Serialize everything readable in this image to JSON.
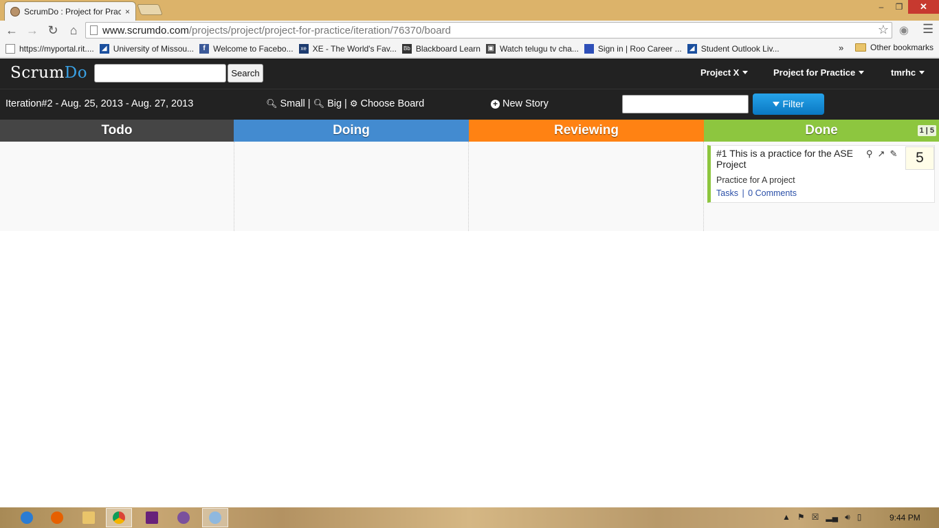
{
  "browser": {
    "tab_title": "ScrumDo : Project for Prac",
    "tab_close": "×",
    "url_host": "www.scrumdo.com",
    "url_path": "/projects/project/project-for-practice/iteration/76370/board",
    "window_controls": {
      "minimize": "–",
      "restore": "❐",
      "close": "✕"
    }
  },
  "bookmarks": {
    "items": [
      {
        "label": "https://myportal.rit....",
        "icon": "page-icon",
        "color": "#ffffff"
      },
      {
        "label": "University of Missou...",
        "icon": "umkc-icon",
        "color": "#1b4f9e"
      },
      {
        "label": "Welcome to Facebo...",
        "icon": "facebook-icon",
        "color": "#3b5998"
      },
      {
        "label": "XE - The World's Fav...",
        "icon": "xe-icon",
        "color": "#1d3b6f"
      },
      {
        "label": "Blackboard Learn",
        "icon": "blackboard-icon",
        "color": "#333333"
      },
      {
        "label": "Watch telugu tv cha...",
        "icon": "tv-icon",
        "color": "#444444"
      },
      {
        "label": "Sign in | Roo Career ...",
        "icon": "roo-icon",
        "color": "#2e4fb8"
      },
      {
        "label": "Student Outlook Liv...",
        "icon": "umkc-icon",
        "color": "#1b4f9e"
      }
    ],
    "more": "»",
    "other": "Other bookmarks"
  },
  "app": {
    "logo_scrum": "Scrum",
    "logo_do": "Do",
    "search_button": "Search",
    "menus": [
      "Project X",
      "Project for Practice",
      "tmrhc"
    ]
  },
  "iteration": {
    "title": "Iteration#2 - Aug. 25, 2013 - Aug. 27, 2013",
    "small": "Small",
    "big": "Big",
    "choose_board": "Choose Board",
    "separator": "|",
    "new_story": "New Story",
    "filter": "Filter"
  },
  "board": {
    "columns": [
      {
        "name": "Todo",
        "color": "#454545"
      },
      {
        "name": "Doing",
        "color": "#438bd0"
      },
      {
        "name": "Reviewing",
        "color": "#ff8213"
      },
      {
        "name": "Done",
        "color": "#8dc63f"
      }
    ],
    "done_count": "1 | 5",
    "card": {
      "title": "#1  This is a practice for the ASE Project",
      "description": "Practice for A project",
      "tasks_link": "Tasks",
      "comments_link": "0 Comments",
      "points": "5",
      "accent": "#8dc63f"
    }
  },
  "taskbar": {
    "clock": "9:44 PM"
  }
}
